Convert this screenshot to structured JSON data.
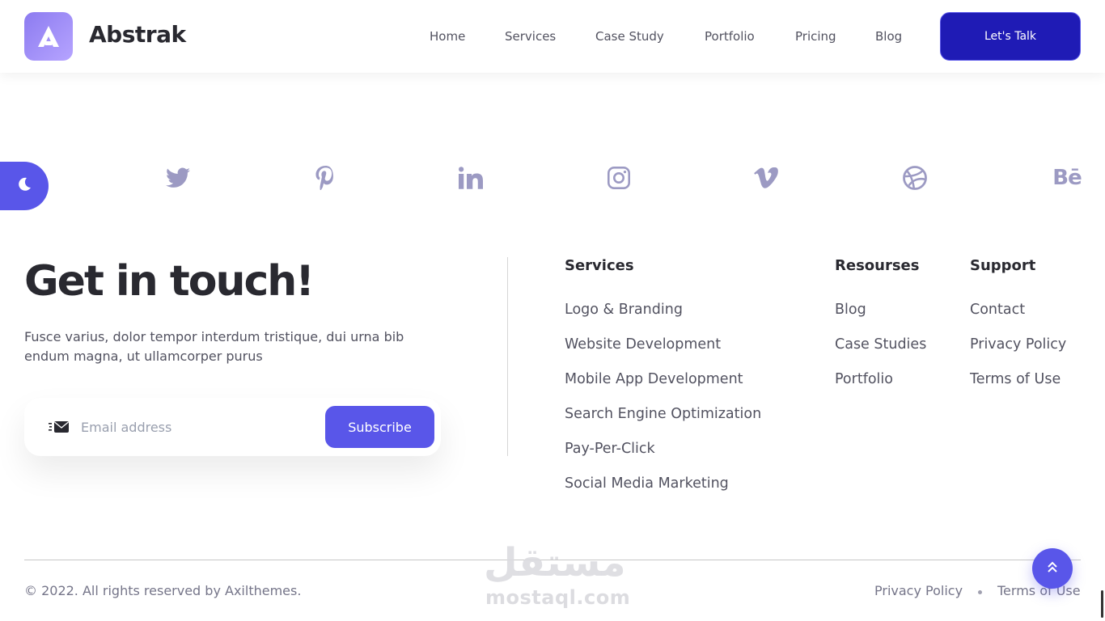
{
  "header": {
    "brand": "Abstrak",
    "nav": [
      "Home",
      "Services",
      "Case Study",
      "Portfolio",
      "Pricing",
      "Blog"
    ],
    "cta": "Let's Talk"
  },
  "social": [
    "twitter-icon",
    "pinterest-icon",
    "linkedin-icon",
    "instagram-icon",
    "vimeo-icon",
    "dribbble-icon",
    "behance-icon"
  ],
  "behance_text": "Bē",
  "contact": {
    "title": "Get in touch!",
    "description": "Fusce varius, dolor tempor interdum tristique, dui urna bib endum magna, ut ullamcorper purus",
    "email_placeholder": "Email address",
    "subscribe": "Subscribe"
  },
  "columns": {
    "services": {
      "heading": "Services",
      "links": [
        "Logo & Branding",
        "Website Development",
        "Mobile App Development",
        "Search Engine Optimization",
        "Pay-Per-Click",
        "Social Media Marketing"
      ]
    },
    "resources": {
      "heading": "Resourses",
      "links": [
        "Blog",
        "Case Studies",
        "Portfolio"
      ]
    },
    "support": {
      "heading": "Support",
      "links": [
        "Contact",
        "Privacy Policy",
        "Terms of Use"
      ]
    }
  },
  "footer": {
    "copyright": "© 2022. All rights reserved by Axilthemes.",
    "privacy": "Privacy Policy",
    "terms": "Terms of Use"
  },
  "watermark": {
    "arabic": "مستقل",
    "latin": "mostaql.com"
  },
  "colors": {
    "primary": "#5956e9",
    "cta": "#1f1bb5",
    "icon": "#9c9ac3"
  }
}
